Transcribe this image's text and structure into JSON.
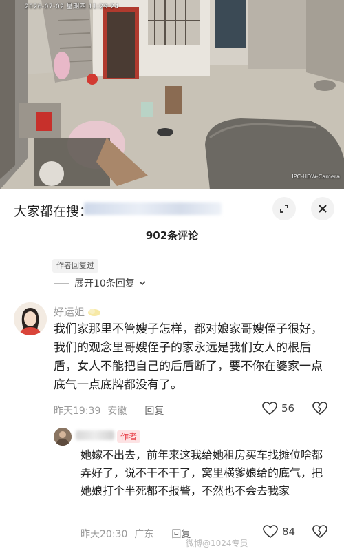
{
  "video": {
    "timestamp": "2026-07-02 星期四 11:29:24",
    "camera_label": "IPC-HDW-Camera"
  },
  "header": {
    "search_prefix": "大家都在搜："
  },
  "comments_title": "902条评论",
  "thread": {
    "author_replied_badge": "作者回复过",
    "expand_label": "展开10条回复"
  },
  "comment1": {
    "username": "好运姐",
    "text": "我们家那里不管嫂子怎样，都对娘家哥嫂侄子很好，我们的观念里哥嫂侄子的家永远是我们女人的根后盾，女人不能把自己的后盾断了，要不你在婆家一点底气一点底牌都没有了。",
    "time": "昨天19:39",
    "location": "安徽",
    "reply_label": "回复",
    "likes": "56"
  },
  "comment2": {
    "author_tag": "作者",
    "text": "她嫁不出去，前年来这我给她租房买车找摊位啥都弄好了，说不干不干了，窝里横爹娘给的底气，把她娘打个半死都不报警，不然也不会去我家",
    "time": "昨天20:30",
    "location": "广东",
    "reply_label": "回复",
    "likes": "84"
  },
  "watermark": "微博@1024专员",
  "colors": {
    "author_tag_bg": "#fde3e4",
    "author_tag_text": "#e8434c",
    "meta_gray": "#9a9a9a"
  },
  "icons": {
    "expand": "expand-icon",
    "close": "close-icon",
    "chevron": "chevron-down-icon",
    "like": "heart-icon",
    "dislike": "broken-heart-icon"
  }
}
